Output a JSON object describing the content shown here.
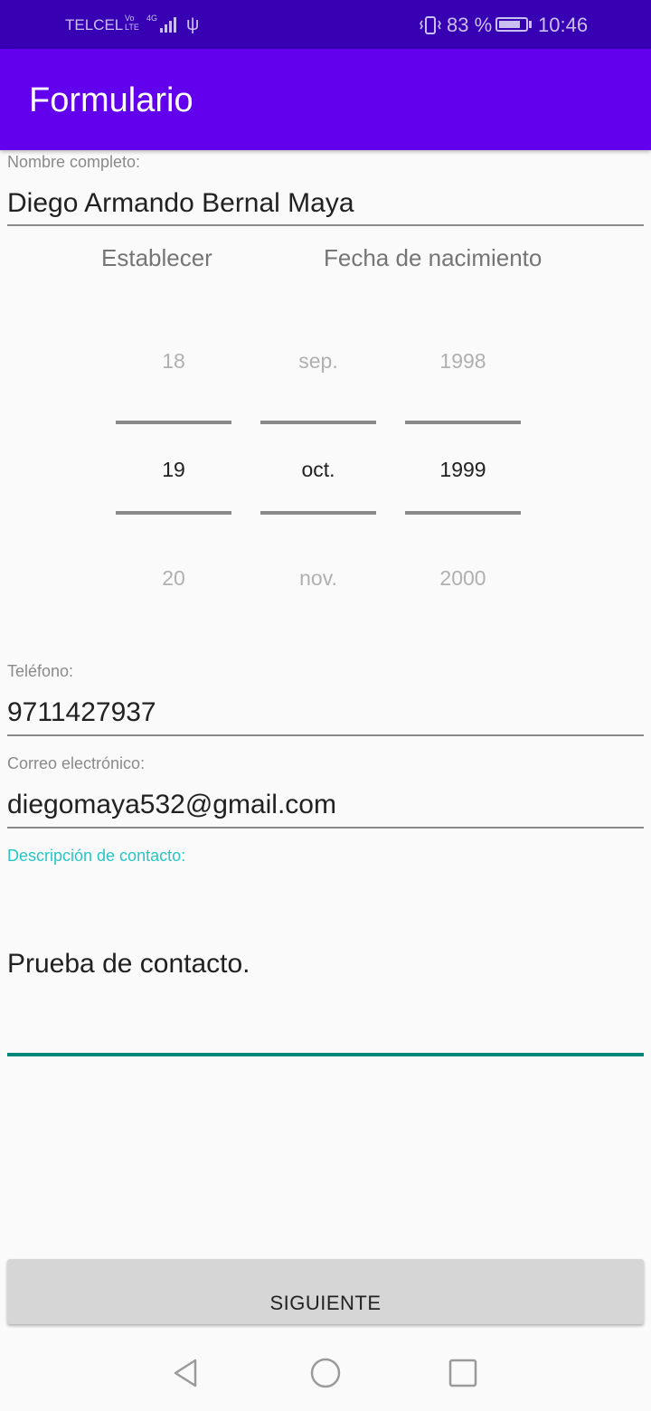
{
  "status_bar": {
    "carrier": "TELCEL",
    "volte_top": "Vo",
    "volte_bottom": "LTE",
    "network": "4G",
    "battery_percent": "83 %",
    "battery_level": 0.83,
    "time": "10:46",
    "icons": [
      "signal-icon",
      "usb-icon",
      "vibrate-icon",
      "battery-charging-icon"
    ]
  },
  "app_bar": {
    "title": "Formulario",
    "color": "#6200ee"
  },
  "form": {
    "name_label": "Nombre completo:",
    "name_value": "Diego Armando Bernal Maya",
    "date_set_label": "Establecer",
    "date_title": "Fecha de nacimiento",
    "date_picker": {
      "day": {
        "prev": "18",
        "selected": "19",
        "next": "20"
      },
      "month": {
        "prev": "sep.",
        "selected": "oct.",
        "next": "nov."
      },
      "year": {
        "prev": "1998",
        "selected": "1999",
        "next": "2000"
      }
    },
    "phone_label": "Teléfono:",
    "phone_value": "9711427937",
    "email_label": "Correo electrónico:",
    "email_value": "diegomaya532@gmail.com",
    "description_label": "Descripción de contacto:",
    "description_value": "Prueba de contacto.",
    "accent_color": "#00897b"
  },
  "next_button": {
    "label": "SIGUIENTE"
  },
  "nav_bar": {
    "icons": [
      "back-icon",
      "home-icon",
      "recents-icon"
    ]
  }
}
